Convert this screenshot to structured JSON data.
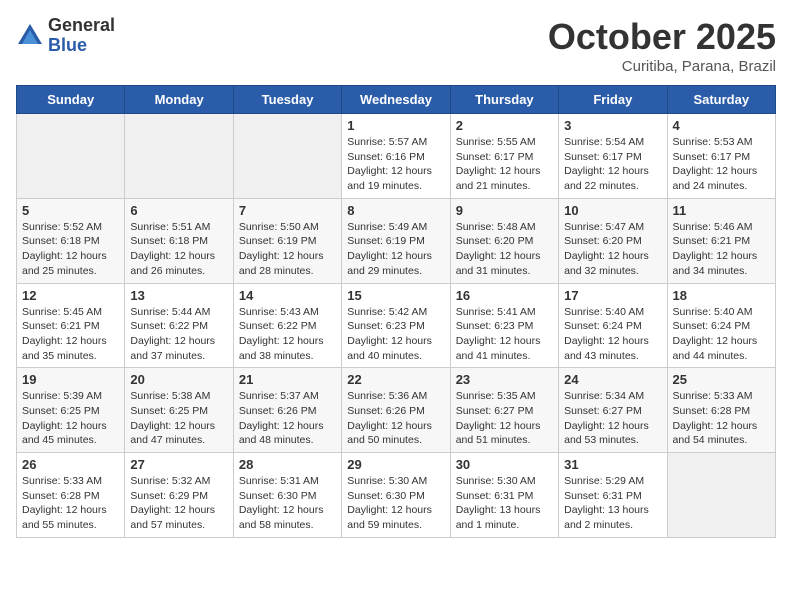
{
  "header": {
    "logo_general": "General",
    "logo_blue": "Blue",
    "month_title": "October 2025",
    "subtitle": "Curitiba, Parana, Brazil"
  },
  "weekdays": [
    "Sunday",
    "Monday",
    "Tuesday",
    "Wednesday",
    "Thursday",
    "Friday",
    "Saturday"
  ],
  "weeks": [
    [
      {
        "day": "",
        "info": ""
      },
      {
        "day": "",
        "info": ""
      },
      {
        "day": "",
        "info": ""
      },
      {
        "day": "1",
        "info": "Sunrise: 5:57 AM\nSunset: 6:16 PM\nDaylight: 12 hours\nand 19 minutes."
      },
      {
        "day": "2",
        "info": "Sunrise: 5:55 AM\nSunset: 6:17 PM\nDaylight: 12 hours\nand 21 minutes."
      },
      {
        "day": "3",
        "info": "Sunrise: 5:54 AM\nSunset: 6:17 PM\nDaylight: 12 hours\nand 22 minutes."
      },
      {
        "day": "4",
        "info": "Sunrise: 5:53 AM\nSunset: 6:17 PM\nDaylight: 12 hours\nand 24 minutes."
      }
    ],
    [
      {
        "day": "5",
        "info": "Sunrise: 5:52 AM\nSunset: 6:18 PM\nDaylight: 12 hours\nand 25 minutes."
      },
      {
        "day": "6",
        "info": "Sunrise: 5:51 AM\nSunset: 6:18 PM\nDaylight: 12 hours\nand 26 minutes."
      },
      {
        "day": "7",
        "info": "Sunrise: 5:50 AM\nSunset: 6:19 PM\nDaylight: 12 hours\nand 28 minutes."
      },
      {
        "day": "8",
        "info": "Sunrise: 5:49 AM\nSunset: 6:19 PM\nDaylight: 12 hours\nand 29 minutes."
      },
      {
        "day": "9",
        "info": "Sunrise: 5:48 AM\nSunset: 6:20 PM\nDaylight: 12 hours\nand 31 minutes."
      },
      {
        "day": "10",
        "info": "Sunrise: 5:47 AM\nSunset: 6:20 PM\nDaylight: 12 hours\nand 32 minutes."
      },
      {
        "day": "11",
        "info": "Sunrise: 5:46 AM\nSunset: 6:21 PM\nDaylight: 12 hours\nand 34 minutes."
      }
    ],
    [
      {
        "day": "12",
        "info": "Sunrise: 5:45 AM\nSunset: 6:21 PM\nDaylight: 12 hours\nand 35 minutes."
      },
      {
        "day": "13",
        "info": "Sunrise: 5:44 AM\nSunset: 6:22 PM\nDaylight: 12 hours\nand 37 minutes."
      },
      {
        "day": "14",
        "info": "Sunrise: 5:43 AM\nSunset: 6:22 PM\nDaylight: 12 hours\nand 38 minutes."
      },
      {
        "day": "15",
        "info": "Sunrise: 5:42 AM\nSunset: 6:23 PM\nDaylight: 12 hours\nand 40 minutes."
      },
      {
        "day": "16",
        "info": "Sunrise: 5:41 AM\nSunset: 6:23 PM\nDaylight: 12 hours\nand 41 minutes."
      },
      {
        "day": "17",
        "info": "Sunrise: 5:40 AM\nSunset: 6:24 PM\nDaylight: 12 hours\nand 43 minutes."
      },
      {
        "day": "18",
        "info": "Sunrise: 5:40 AM\nSunset: 6:24 PM\nDaylight: 12 hours\nand 44 minutes."
      }
    ],
    [
      {
        "day": "19",
        "info": "Sunrise: 5:39 AM\nSunset: 6:25 PM\nDaylight: 12 hours\nand 45 minutes."
      },
      {
        "day": "20",
        "info": "Sunrise: 5:38 AM\nSunset: 6:25 PM\nDaylight: 12 hours\nand 47 minutes."
      },
      {
        "day": "21",
        "info": "Sunrise: 5:37 AM\nSunset: 6:26 PM\nDaylight: 12 hours\nand 48 minutes."
      },
      {
        "day": "22",
        "info": "Sunrise: 5:36 AM\nSunset: 6:26 PM\nDaylight: 12 hours\nand 50 minutes."
      },
      {
        "day": "23",
        "info": "Sunrise: 5:35 AM\nSunset: 6:27 PM\nDaylight: 12 hours\nand 51 minutes."
      },
      {
        "day": "24",
        "info": "Sunrise: 5:34 AM\nSunset: 6:27 PM\nDaylight: 12 hours\nand 53 minutes."
      },
      {
        "day": "25",
        "info": "Sunrise: 5:33 AM\nSunset: 6:28 PM\nDaylight: 12 hours\nand 54 minutes."
      }
    ],
    [
      {
        "day": "26",
        "info": "Sunrise: 5:33 AM\nSunset: 6:28 PM\nDaylight: 12 hours\nand 55 minutes."
      },
      {
        "day": "27",
        "info": "Sunrise: 5:32 AM\nSunset: 6:29 PM\nDaylight: 12 hours\nand 57 minutes."
      },
      {
        "day": "28",
        "info": "Sunrise: 5:31 AM\nSunset: 6:30 PM\nDaylight: 12 hours\nand 58 minutes."
      },
      {
        "day": "29",
        "info": "Sunrise: 5:30 AM\nSunset: 6:30 PM\nDaylight: 12 hours\nand 59 minutes."
      },
      {
        "day": "30",
        "info": "Sunrise: 5:30 AM\nSunset: 6:31 PM\nDaylight: 13 hours\nand 1 minute."
      },
      {
        "day": "31",
        "info": "Sunrise: 5:29 AM\nSunset: 6:31 PM\nDaylight: 13 hours\nand 2 minutes."
      },
      {
        "day": "",
        "info": ""
      }
    ]
  ]
}
